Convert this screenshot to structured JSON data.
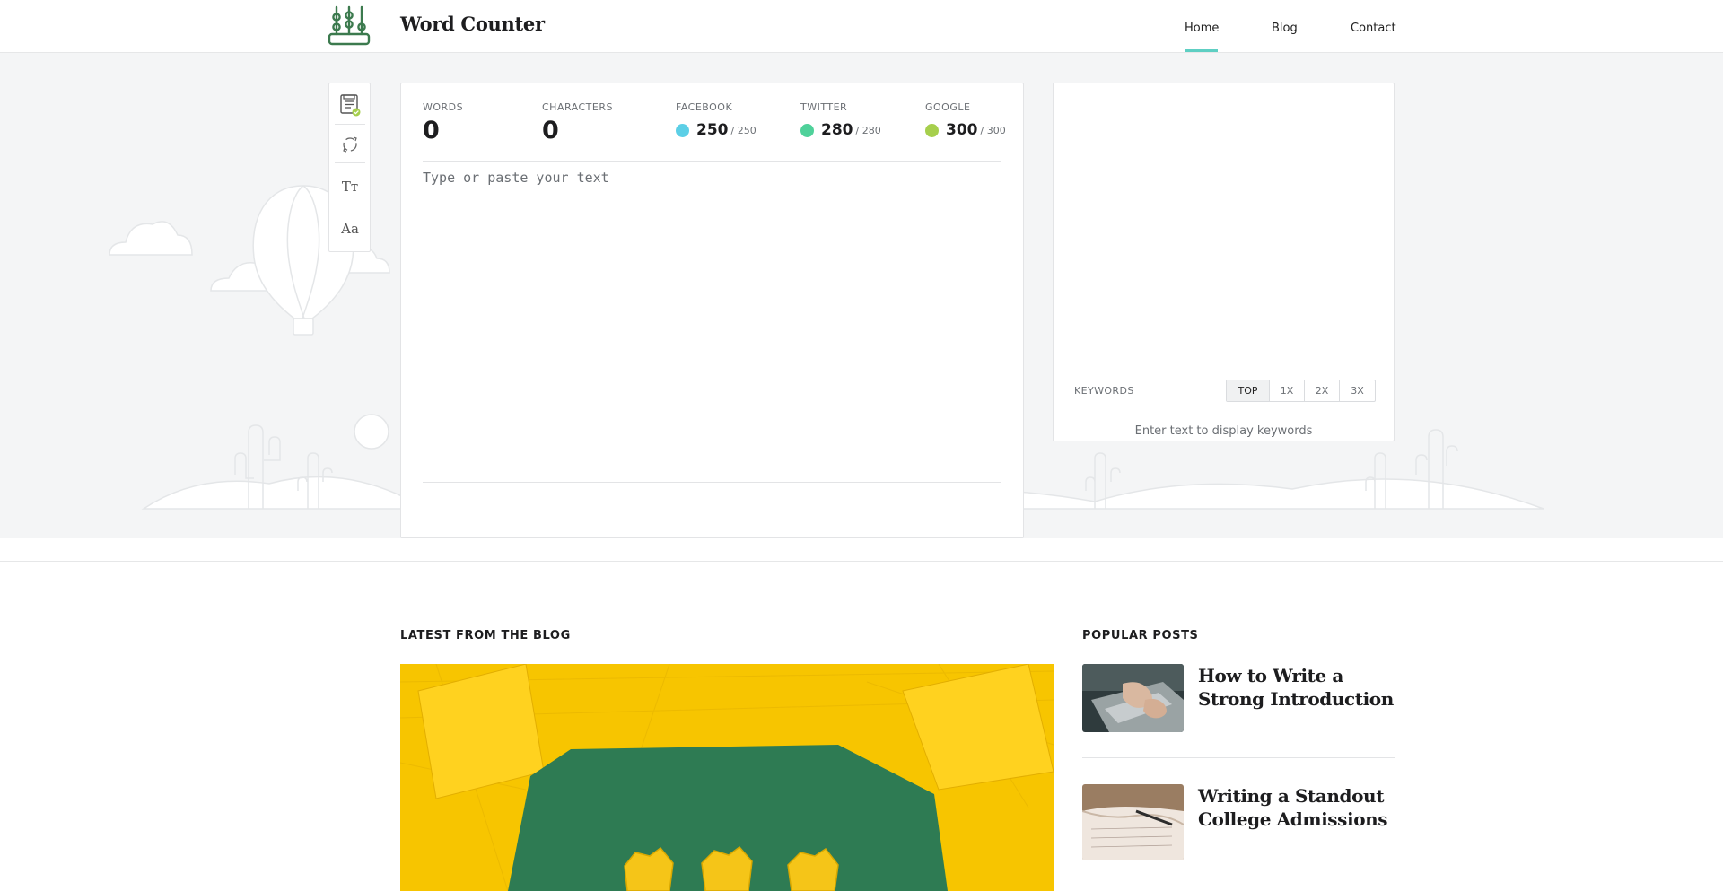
{
  "header": {
    "brand": "Word Counter",
    "nav": [
      {
        "label": "Home",
        "active": true
      },
      {
        "label": "Blog",
        "active": false
      },
      {
        "label": "Contact",
        "active": false
      }
    ]
  },
  "toolbar": {
    "tools": [
      {
        "name": "save-icon"
      },
      {
        "name": "refresh-icon"
      },
      {
        "name": "text-size-icon",
        "text": "Tт"
      },
      {
        "name": "font-icon",
        "text": "Aa"
      }
    ]
  },
  "editor": {
    "stats": {
      "words": {
        "label": "WORDS",
        "value": "0"
      },
      "characters": {
        "label": "CHARACTERS",
        "value": "0"
      },
      "facebook": {
        "label": "FACEBOOK",
        "value": "250",
        "limit": "/ 250",
        "color": "#5ccfe6"
      },
      "twitter": {
        "label": "TWITTER",
        "value": "280",
        "limit": "/ 280",
        "color": "#4fd19a"
      },
      "google": {
        "label": "GOOGLE",
        "value": "300",
        "limit": "/ 300",
        "color": "#a6cf4d"
      }
    },
    "placeholder": "Type or paste your text"
  },
  "keywords": {
    "label": "KEYWORDS",
    "tabs": [
      "TOP",
      "1X",
      "2X",
      "3X"
    ],
    "active_tab": "TOP",
    "empty_text": "Enter text to display keywords"
  },
  "blog": {
    "latest_title": "LATEST FROM THE BLOG",
    "popular_title": "POPULAR POSTS",
    "popular_posts": [
      {
        "title": "How to Write a Strong Introduction"
      },
      {
        "title": "Writing a Standout College Admissions"
      }
    ]
  },
  "colors": {
    "accent": "#5ecfc3",
    "logo_green": "#3c7a4e"
  }
}
